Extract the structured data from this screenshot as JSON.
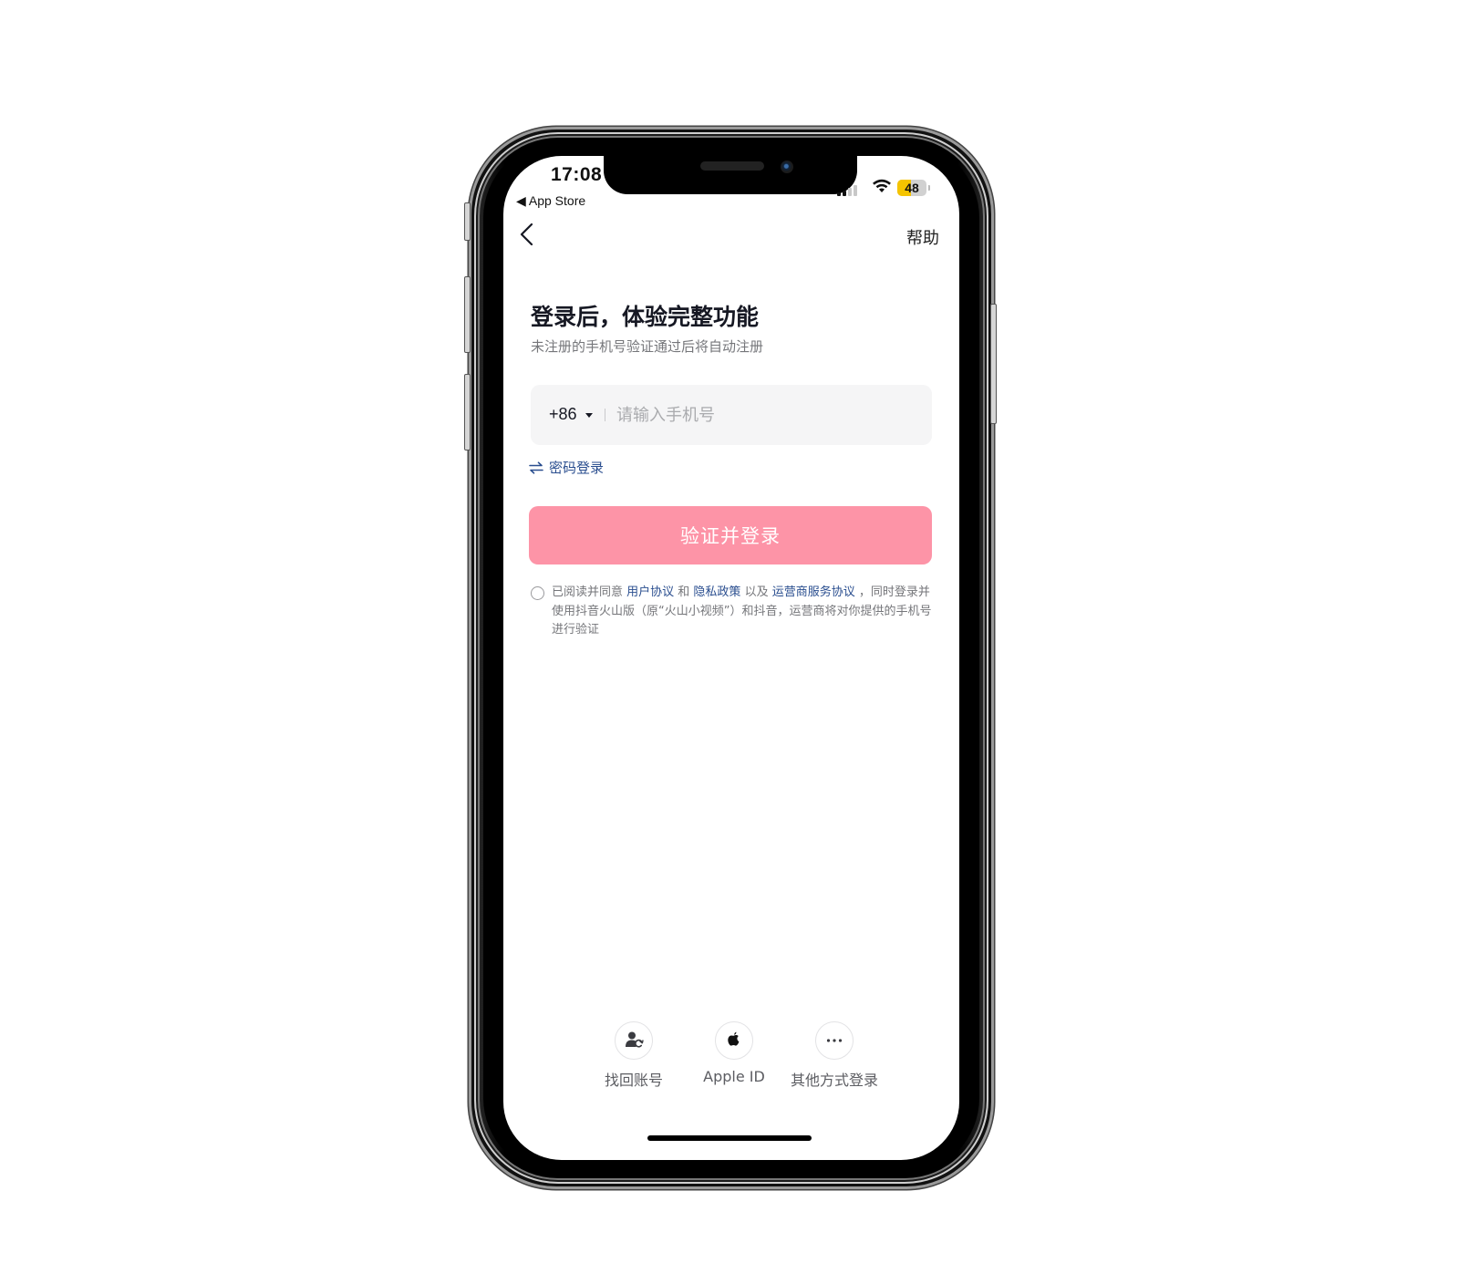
{
  "status_bar": {
    "time": "17:08",
    "back_to_app": "◀ App Store",
    "battery_level": 48,
    "battery_label": "48",
    "wifi": "wifi-icon",
    "signal": "signal-bars-icon"
  },
  "nav": {
    "back_icon": "chevron-left-icon",
    "help_label": "帮助"
  },
  "header": {
    "title": "登录后，体验完整功能",
    "subtitle": "未注册的手机号验证通过后将自动注册"
  },
  "phone_input": {
    "country_code": "+86",
    "value": "",
    "placeholder": "请输入手机号"
  },
  "password_login": {
    "icon": "swap-arrows-icon",
    "label": "密码登录"
  },
  "submit": {
    "label": "验证并登录",
    "color": "#fd94a7",
    "enabled": false
  },
  "agreement": {
    "checked": false,
    "prefix": "已阅读并同意 ",
    "link_user": "用户协议",
    "and": " 和 ",
    "link_privacy": "隐私政策",
    "as_well": " 以及 ",
    "link_carrier": "运营商服务协议",
    "suffix": " ，同时登录并使用抖音火山版（原“火山小视频”）和抖音，运营商将对你提供的手机号进行验证",
    "link_color": "#2a4e8f"
  },
  "other_options": [
    {
      "icon": "account-recover-icon",
      "label": "找回账号"
    },
    {
      "icon": "apple-icon",
      "label": "Apple ID"
    },
    {
      "icon": "more-dots-icon",
      "label": "其他方式登录"
    }
  ]
}
